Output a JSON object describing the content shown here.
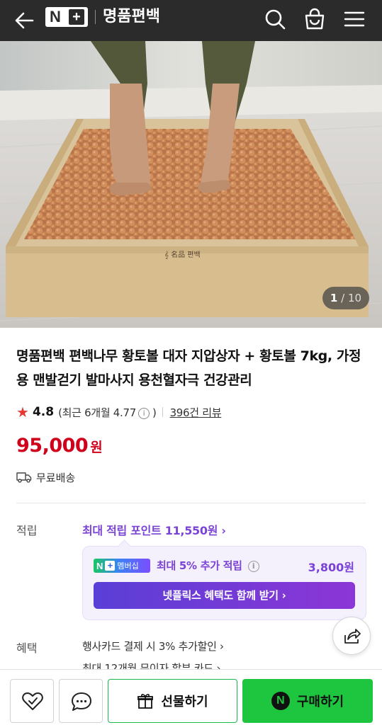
{
  "header": {
    "logo_n": "N",
    "logo_plus": "+",
    "store_name": "명품편백",
    "icons": [
      "back-arrow-icon",
      "search-icon",
      "shopping-bag-icon",
      "hamburger-menu-icon"
    ]
  },
  "gallery": {
    "current": "1",
    "separator": "/",
    "total": "10"
  },
  "product": {
    "title": "명품편백 편백나무 황토볼 대자 지압상자 + 황토볼 7kg, 가정용 맨발걷기 발마사지 용천혈자극 건강관리",
    "rating": "4.8",
    "recent_rating_prefix": "(최근 6개월 4.77",
    "recent_rating_suffix": ")",
    "info_glyph": "i",
    "review_count": "396건 리뷰",
    "price_value": "95,000",
    "price_unit": "원",
    "shipping": "무료배송"
  },
  "points": {
    "label": "적립",
    "max_points": "최대 적립 포인트 11,550원 ›",
    "badge_n": "N",
    "badge_plus": "+",
    "badge_membership": "멤버십",
    "extra_label": "최대 5% 추가 적립",
    "extra_amount": "3,800원",
    "netflix_button": "넷플릭스 혜택도 함께 받기 ›"
  },
  "benefits": {
    "label": "혜택",
    "item_1": "행사카드 결제 시 3% 추가할인 ›",
    "item_2": "최대 12개월 무이자 할부 카드 ›"
  },
  "bottom_bar": {
    "gift_label": "선물하기",
    "buy_n": "N",
    "buy_label": "구매하기"
  },
  "colors": {
    "header_bg": "#2b2b2b",
    "price_red": "#d0021b",
    "points_purple": "#7b43d6",
    "buy_green": "#1ec53e",
    "star_red": "#e53935"
  }
}
